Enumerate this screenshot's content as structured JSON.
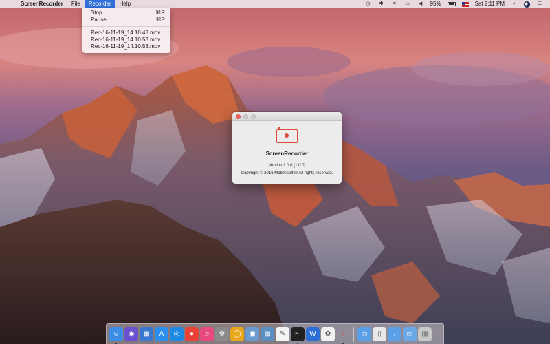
{
  "menubar": {
    "app_name": "ScreenRecorder",
    "menus": [
      "File",
      "Recorder",
      "Help"
    ],
    "active_menu": "Recorder",
    "battery": "95%",
    "clock": "Sat 2:11 PM"
  },
  "dropdown": {
    "actions": [
      {
        "label": "Stop",
        "shortcut": "⌘R"
      },
      {
        "label": "Pause",
        "shortcut": "⌘P"
      }
    ],
    "recordings": [
      "Rec-16-11-19_14.10.43.mov",
      "Rec-16-11-19_14.10.53.mov",
      "Rec-16-11-19_14.10.58.mov"
    ]
  },
  "about_window": {
    "app_name": "ScreenRecorder",
    "version": "Version 1.0.0 (1.0.0)",
    "copyright": "Copyright © 2016 Mobilesoft.kr All rights reserved."
  },
  "dock": {
    "apps": [
      {
        "name": "finder-icon",
        "color": "#3b8de8"
      },
      {
        "name": "siri-icon",
        "color": "#6a4fd0"
      },
      {
        "name": "mission-control-icon",
        "color": "#3a79d0"
      },
      {
        "name": "app-store-icon",
        "color": "#2b8ff0"
      },
      {
        "name": "safari-icon",
        "color": "#1e88e5"
      },
      {
        "name": "chrome-icon",
        "color": "#e94235"
      },
      {
        "name": "itunes-icon",
        "color": "#e84a7d"
      },
      {
        "name": "system-preferences-icon",
        "color": "#8a8a8a"
      },
      {
        "name": "coin-app-icon",
        "color": "#e8a81e"
      },
      {
        "name": "preview-icon",
        "color": "#6b9ad1"
      },
      {
        "name": "image-capture-icon",
        "color": "#5a8fc4"
      },
      {
        "name": "textedit-icon",
        "color": "#f3f3f3"
      },
      {
        "name": "terminal-icon",
        "color": "#222222"
      },
      {
        "name": "word-icon",
        "color": "#2b6fd6"
      },
      {
        "name": "photos-icon",
        "color": "#f2f2f2"
      },
      {
        "name": "screenrecorder-icon",
        "color": "#d9534f"
      }
    ],
    "right_items": [
      {
        "name": "applications-folder-icon",
        "color": "#5aa0e8"
      },
      {
        "name": "script-icon",
        "color": "#e8e8e8"
      },
      {
        "name": "downloads-folder-icon",
        "color": "#5aa0e8"
      },
      {
        "name": "documents-folder-icon",
        "color": "#6aa8e8"
      },
      {
        "name": "trash-icon",
        "color": "#c8c8c8"
      }
    ]
  }
}
